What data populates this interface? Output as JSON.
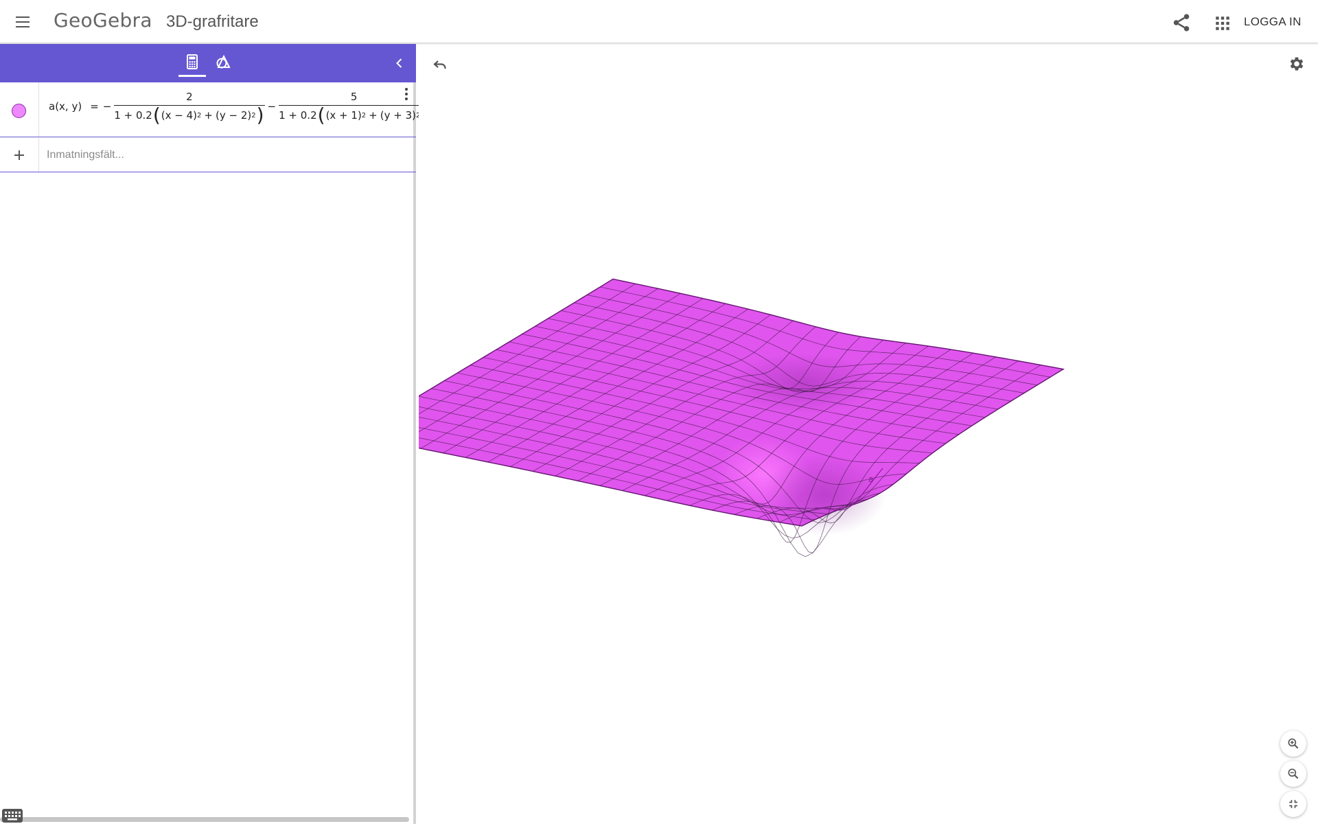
{
  "header": {
    "brand": "GeoGebra",
    "title": "3D-grafritare",
    "login_label": "LOGGA IN"
  },
  "algebra": {
    "function_color": "#ee88ff",
    "formula": {
      "lhs": "a(x, y)",
      "equals": "=",
      "minus1": "−",
      "minus2": "−",
      "term1_num": "2",
      "term1_den_lead": "1 + 0.2",
      "term1_den_a": "(x − 4)",
      "term1_den_plus": "+",
      "term1_den_b": "(y − 2)",
      "term2_num": "5",
      "term2_den_lead": "1 + 0.2",
      "term2_den_a": "(x + 1)",
      "term2_den_plus": "+",
      "term2_den_b": "(y + 3)",
      "exp": "2"
    },
    "input_placeholder": "Inmatningsfält..."
  },
  "graphics": {
    "surface_color": "#e055ee",
    "surface_edge_color": "#8a1f9a",
    "mesh_color": "#3a1a40",
    "label": "a"
  }
}
